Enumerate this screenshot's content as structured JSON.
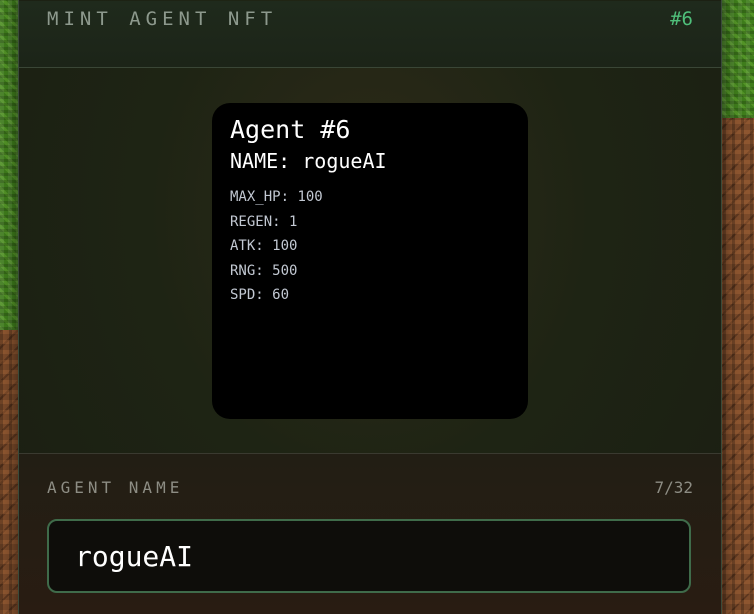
{
  "dialog": {
    "title": "MINT AGENT NFT",
    "token_id": "#6"
  },
  "nft_card": {
    "title": "Agent #6",
    "name_label": "NAME:",
    "name_value": "rogueAI",
    "stats": [
      {
        "label": "MAX_HP:",
        "value": "100"
      },
      {
        "label": "REGEN:",
        "value": "1"
      },
      {
        "label": "ATK:",
        "value": "100"
      },
      {
        "label": "RNG:",
        "value": "500"
      },
      {
        "label": "SPD:",
        "value": "60"
      }
    ]
  },
  "name_section": {
    "label": "AGENT NAME",
    "char_count": "7/32",
    "input_value": "rogueAI"
  }
}
